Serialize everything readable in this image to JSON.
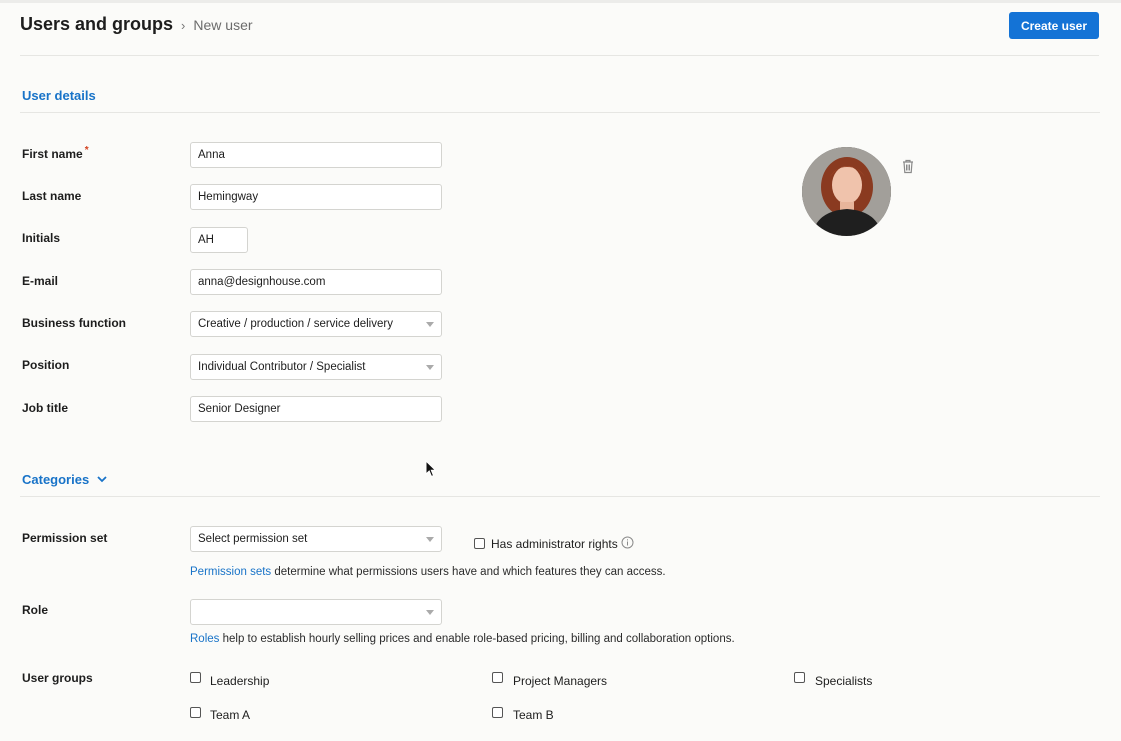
{
  "header": {
    "title": "Users and groups",
    "separator": "›",
    "subtitle": "New user",
    "create_label": "Create user"
  },
  "user_details": {
    "section_title": "User details",
    "required_mark": "*",
    "first_name": {
      "label": "First name",
      "value": "Anna"
    },
    "last_name": {
      "label": "Last name",
      "value": "Hemingway"
    },
    "initials": {
      "label": "Initials",
      "value": "AH"
    },
    "email": {
      "label": "E-mail",
      "value": "anna@designhouse.com"
    },
    "business_function": {
      "label": "Business function",
      "value": "Creative / production / service delivery"
    },
    "position": {
      "label": "Position",
      "value": "Individual Contributor / Specialist"
    },
    "job_title": {
      "label": "Job title",
      "value": "Senior Designer"
    }
  },
  "categories": {
    "section_title": "Categories",
    "permission_set": {
      "label": "Permission set",
      "value": "Select permission set",
      "admin_label": "Has administrator rights",
      "admin_checked": false,
      "hint_link": "Permission sets",
      "hint_text": " determine what permissions users have and which features they can access."
    },
    "role": {
      "label": "Role",
      "value": "",
      "hint_link": "Roles",
      "hint_text": " help to establish hourly selling prices and enable role-based pricing, billing and collaboration options."
    },
    "user_groups": {
      "label": "User groups",
      "items": [
        {
          "label": "Leadership",
          "checked": false
        },
        {
          "label": "Project Managers",
          "checked": false
        },
        {
          "label": "Specialists",
          "checked": false
        },
        {
          "label": "Team A",
          "checked": false
        },
        {
          "label": "Team B",
          "checked": false
        }
      ]
    }
  },
  "icons": {
    "trash": "trash-icon",
    "info": "info-icon",
    "chevron": "chevron-down-icon",
    "caret": "dropdown-caret-icon"
  },
  "colors": {
    "accent": "#1473d6",
    "link": "#1873c8",
    "required": "#d2401f"
  }
}
